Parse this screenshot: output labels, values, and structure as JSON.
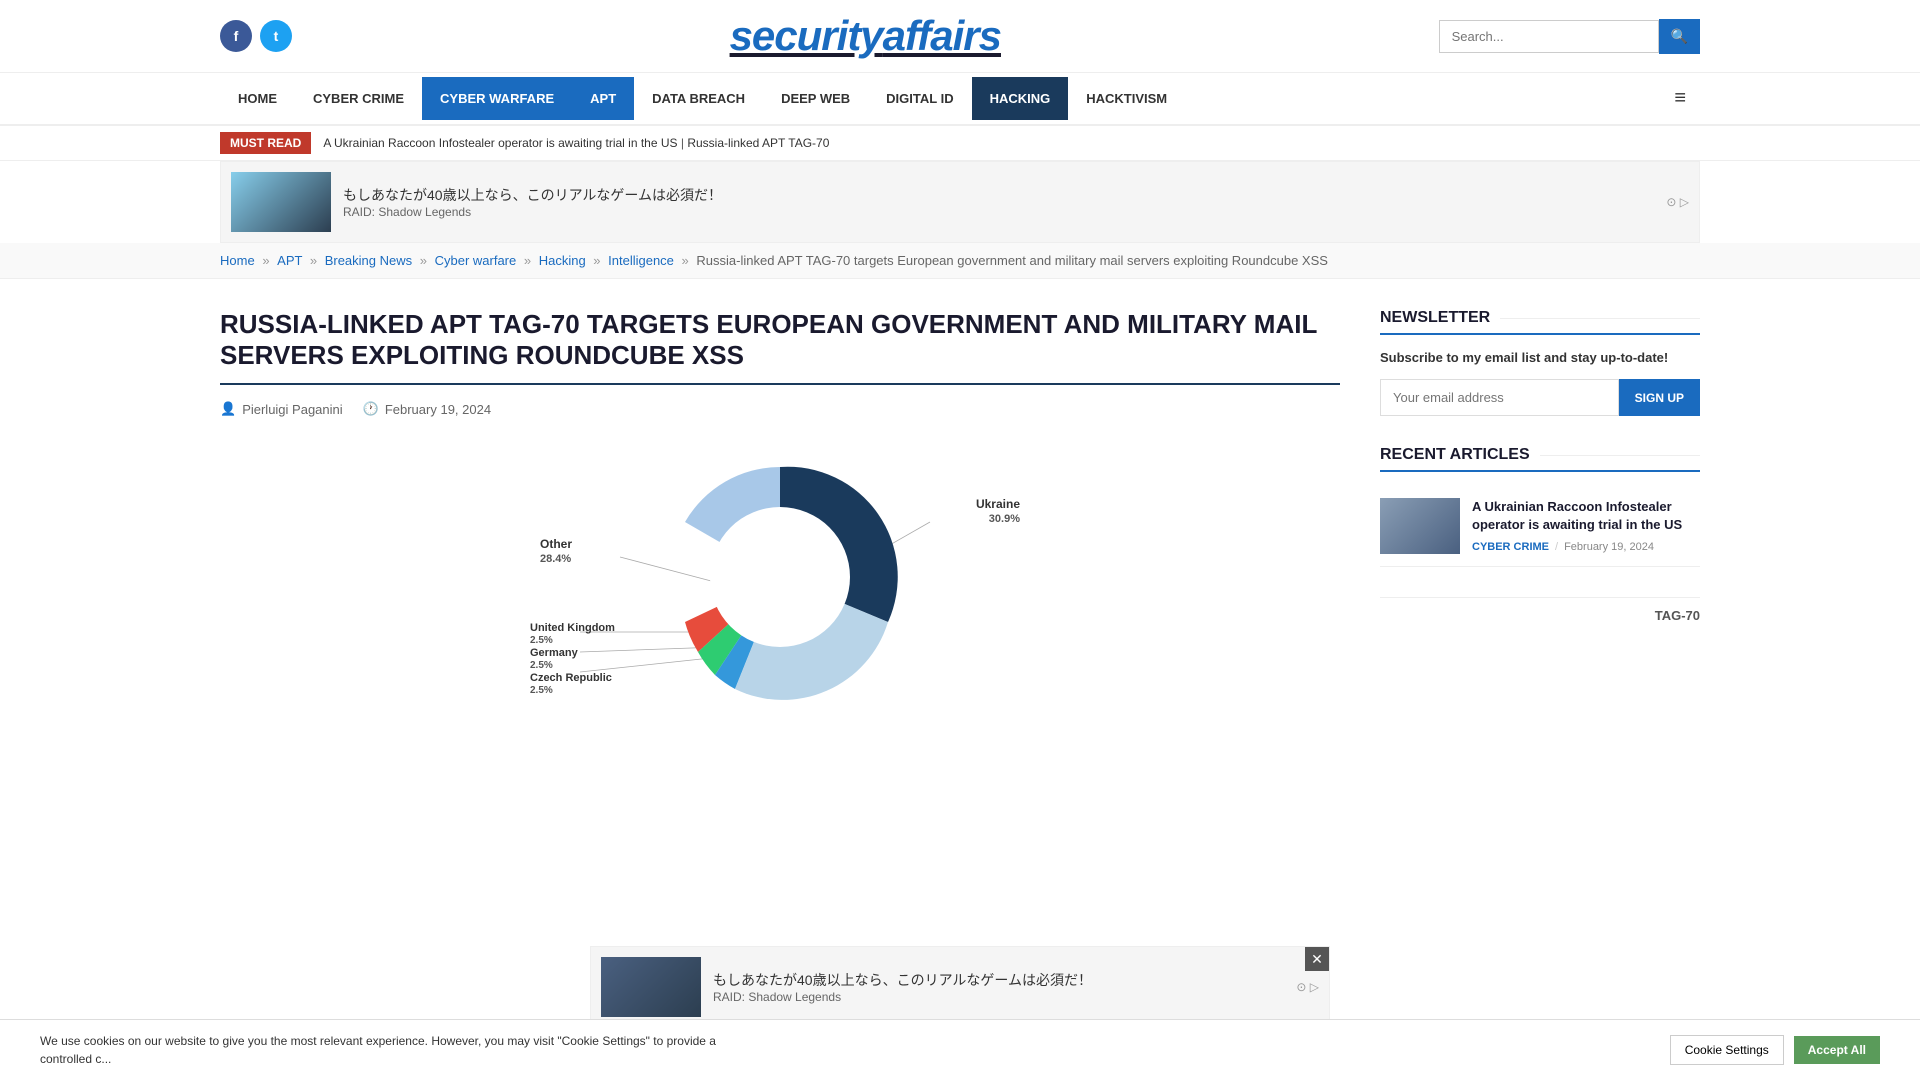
{
  "site": {
    "name_part1": "security",
    "name_part2": "affairs"
  },
  "header": {
    "social": {
      "facebook_label": "f",
      "twitter_label": "t"
    },
    "search_placeholder": "Search...",
    "search_btn_icon": "🔍"
  },
  "nav": {
    "items": [
      {
        "label": "HOME",
        "id": "home",
        "style": "normal"
      },
      {
        "label": "CYBER CRIME",
        "id": "cyber-crime",
        "style": "normal"
      },
      {
        "label": "CYBER WARFARE",
        "id": "cyber-warfare",
        "style": "active-blue"
      },
      {
        "label": "APT",
        "id": "apt",
        "style": "active-blue"
      },
      {
        "label": "DATA BREACH",
        "id": "data-breach",
        "style": "normal"
      },
      {
        "label": "DEEP WEB",
        "id": "deep-web",
        "style": "normal"
      },
      {
        "label": "DIGITAL ID",
        "id": "digital-id",
        "style": "normal"
      },
      {
        "label": "HACKING",
        "id": "hacking",
        "style": "active-navy"
      },
      {
        "label": "HACKTIVISM",
        "id": "hacktivism",
        "style": "normal"
      }
    ]
  },
  "breaking_bar": {
    "badge": "MUST READ",
    "items": [
      "A Ukrainian Raccoon Infostealer operator is awaiting trial in the US",
      "Russia-linked APT TAG-70"
    ],
    "separator": " | "
  },
  "ad_banner": {
    "text": "もしあなたが40歳以上なら、このリアルなゲームは必須だ！",
    "sub": "RAID: Shadow Legends"
  },
  "breadcrumb": {
    "items": [
      {
        "label": "Home",
        "href": "#"
      },
      {
        "label": "APT",
        "href": "#"
      },
      {
        "label": "Breaking News",
        "href": "#"
      },
      {
        "label": "Cyber warfare",
        "href": "#"
      },
      {
        "label": "Hacking",
        "href": "#"
      },
      {
        "label": "Intelligence",
        "href": "#"
      }
    ],
    "current": "Russia-linked APT TAG-70 targets European government and military mail servers exploiting Roundcube XSS"
  },
  "article": {
    "title": "RUSSIA-LINKED APT TAG-70 TARGETS EUROPEAN GOVERNMENT AND MILITARY MAIL SERVERS EXPLOITING ROUNDCUBE XSS",
    "author": "Pierluigi Paganini",
    "date": "February 19, 2024",
    "chart": {
      "segments": [
        {
          "label": "Ukraine",
          "pct": "30.9%",
          "value": 30.9,
          "color": "#1a3a5c"
        },
        {
          "label": "Other",
          "pct": "28.4%",
          "value": 28.4,
          "color": "#7fb3d3"
        },
        {
          "label": "United Kingdom",
          "pct": "2.5%",
          "value": 2.5,
          "color": "#e74c3c"
        },
        {
          "label": "Germany",
          "pct": "2.5%",
          "value": 2.5,
          "color": "#2ecc71"
        },
        {
          "label": "Czech Republic",
          "pct": "2.5%",
          "value": 2.5,
          "color": "#3498db"
        }
      ]
    }
  },
  "sidebar": {
    "newsletter": {
      "title": "NEWSLETTER",
      "description": "Subscribe to my email list and stay up-to-date!",
      "email_placeholder": "Your email address",
      "btn_label": "SIGN UP"
    },
    "recent_articles": {
      "title": "RECENT ARTICLES",
      "items": [
        {
          "title": "A Ukrainian Raccoon Infostealer operator is awaiting trial in the US",
          "category": "CYBER CRIME",
          "date": "February 19, 2024"
        }
      ]
    },
    "tag": "TAG-70"
  },
  "cookie": {
    "text": "We use cookies on our website to give you the most relevant experience. However, you may visit \"Cookie Settings\" to provide a controlled c...",
    "settings_label": "Cookie Settings",
    "accept_label": "Accept All"
  },
  "bottom_ad": {
    "text": "もしあなたが40歳以上なら、このリアルなゲームは必須だ！",
    "sub": "RAID: Shadow Legends",
    "close": "✕"
  }
}
